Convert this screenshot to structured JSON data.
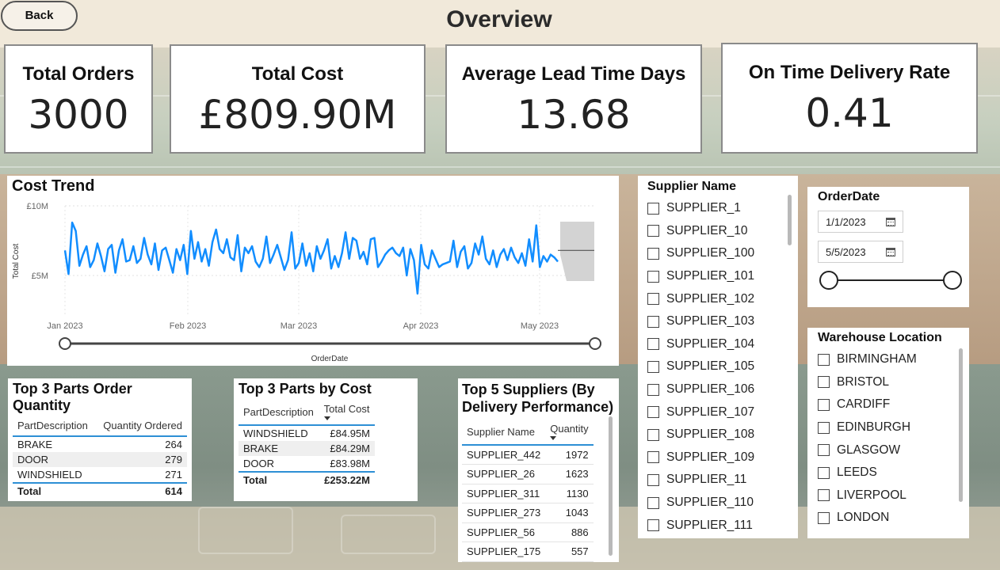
{
  "header": {
    "back_label": "Back",
    "title": "Overview"
  },
  "kpis": [
    {
      "label": "Total Orders",
      "value": "3000"
    },
    {
      "label": "Total Cost",
      "value": "£809.90M"
    },
    {
      "label": "Average Lead Time Days",
      "value": "13.68"
    },
    {
      "label": "On Time Delivery Rate",
      "value": "0.41"
    }
  ],
  "cost_trend": {
    "title": "Cost Trend",
    "y_ticks": [
      "£10M",
      "£5M"
    ],
    "y_label": "Total Cost",
    "x_ticks": [
      "Jan 2023",
      "Feb 2023",
      "Mar 2023",
      "Apr 2023",
      "May 2023"
    ],
    "x_label": "OrderDate"
  },
  "chart_data": {
    "type": "line",
    "title": "Cost Trend",
    "xlabel": "OrderDate",
    "ylabel": "Total Cost",
    "ylim": [
      3,
      10
    ],
    "x_start": "2023-01-01",
    "series": [
      {
        "name": "Total Cost",
        "values": [
          6.8,
          5.1,
          8.8,
          8.2,
          5.7,
          6.5,
          7.1,
          5.6,
          6.1,
          7.3,
          6.4,
          5.3,
          6.9,
          7.2,
          5.2,
          6.8,
          7.6,
          6.0,
          6.1,
          7.1,
          5.9,
          6.2,
          7.7,
          6.5,
          5.8,
          7.3,
          5.4,
          6.8,
          7.0,
          6.1,
          5.2,
          6.9,
          6.1,
          7.2,
          5.1,
          8.2,
          6.2,
          7.4,
          6.0,
          6.9,
          5.7,
          7.4,
          8.3,
          6.9,
          6.6,
          7.6,
          6.3,
          6.1,
          7.9,
          5.3,
          7.0,
          6.6,
          7.1,
          6.0,
          5.6,
          6.2,
          7.8,
          5.9,
          6.5,
          7.2,
          6.3,
          5.4,
          6.1,
          8.1,
          5.5,
          5.9,
          7.3,
          5.7,
          6.6,
          5.3,
          7.1,
          6.2,
          6.8,
          7.6,
          5.5,
          6.4,
          5.6,
          6.6,
          8.1,
          6.2,
          7.7,
          7.5,
          6.2,
          6.7,
          5.8,
          7.6,
          7.7,
          5.6,
          6.0,
          6.5,
          6.8,
          7.0,
          6.6,
          6.4,
          7.0,
          5.0,
          6.9,
          6.1,
          3.7,
          7.2,
          5.8,
          5.5,
          6.8,
          6.2,
          5.6,
          5.8,
          5.9,
          6.0,
          7.5,
          5.6,
          6.7,
          7.1,
          5.5,
          5.9,
          7.3,
          6.5,
          7.8,
          6.2,
          5.8,
          6.8,
          5.6,
          6.5,
          6.9,
          6.1,
          7.0,
          6.3,
          5.9,
          6.6,
          5.7,
          7.6,
          6.0,
          8.6,
          5.6,
          6.4,
          6.0,
          6.5,
          6.3,
          6.0
        ]
      },
      {
        "name": "Forecast",
        "values": [
          6.8,
          6.8,
          6.8,
          6.8,
          6.8
        ]
      }
    ]
  },
  "top_parts_qty": {
    "title": "Top 3 Parts Order Quantity",
    "columns": [
      "PartDescription",
      "Quantity Ordered"
    ],
    "rows": [
      [
        "BRAKE",
        "264"
      ],
      [
        "DOOR",
        "279"
      ],
      [
        "WINDSHIELD",
        "271"
      ]
    ],
    "total": [
      "Total",
      "614"
    ]
  },
  "top_parts_cost": {
    "title": "Top 3 Parts by Cost",
    "columns": [
      "PartDescription",
      "Total Cost"
    ],
    "rows": [
      [
        "WINDSHIELD",
        "£84.95M"
      ],
      [
        "BRAKE",
        "£84.29M"
      ],
      [
        "DOOR",
        "£83.98M"
      ]
    ],
    "total": [
      "Total",
      "£253.22M"
    ]
  },
  "top_suppliers": {
    "title": "Top 5 Suppliers (By Delivery Performance)",
    "columns": [
      "Supplier Name",
      "Quantity"
    ],
    "rows": [
      [
        "SUPPLIER_442",
        "1972"
      ],
      [
        "SUPPLIER_26",
        "1623"
      ],
      [
        "SUPPLIER_311",
        "1130"
      ],
      [
        "SUPPLIER_273",
        "1043"
      ],
      [
        "SUPPLIER_56",
        "886"
      ],
      [
        "SUPPLIER_175",
        "557"
      ]
    ]
  },
  "supplier_slicer": {
    "title": "Supplier Name",
    "items": [
      "SUPPLIER_1",
      "SUPPLIER_10",
      "SUPPLIER_100",
      "SUPPLIER_101",
      "SUPPLIER_102",
      "SUPPLIER_103",
      "SUPPLIER_104",
      "SUPPLIER_105",
      "SUPPLIER_106",
      "SUPPLIER_107",
      "SUPPLIER_108",
      "SUPPLIER_109",
      "SUPPLIER_11",
      "SUPPLIER_110",
      "SUPPLIER_111"
    ]
  },
  "date_slicer": {
    "title": "OrderDate",
    "start": "1/1/2023",
    "end": "5/5/2023"
  },
  "warehouse_slicer": {
    "title": "Warehouse Location",
    "items": [
      "BIRMINGHAM",
      "BRISTOL",
      "CARDIFF",
      "EDINBURGH",
      "GLASGOW",
      "LEEDS",
      "LIVERPOOL",
      "LONDON"
    ]
  },
  "colors": {
    "line": "#118dff",
    "accent": "#2d8fd5",
    "forecast_band": "#d3d3d3"
  }
}
